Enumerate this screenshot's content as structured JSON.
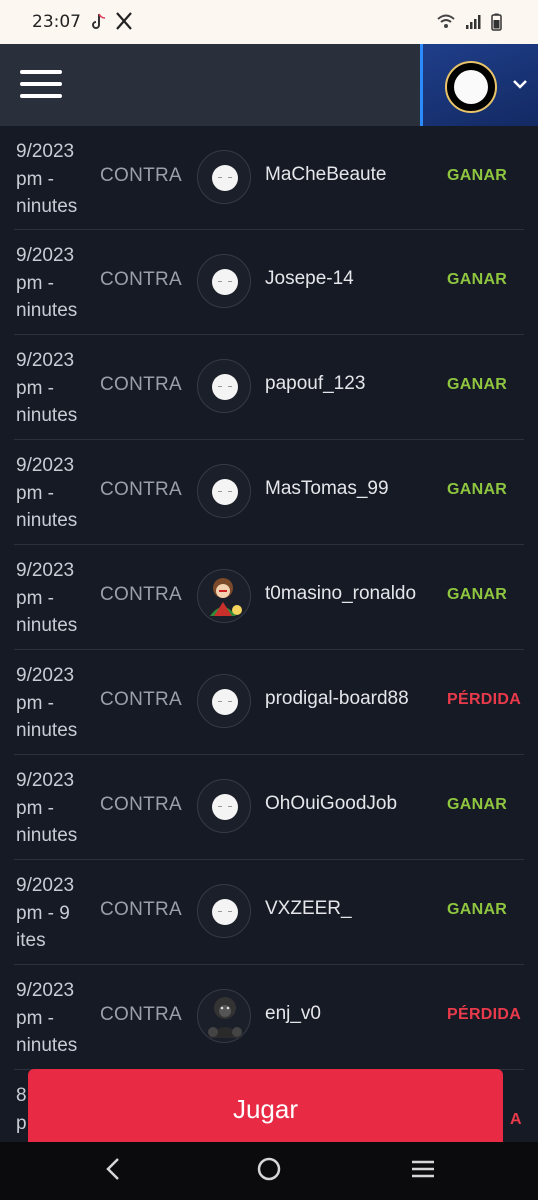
{
  "status": {
    "time": "23:07",
    "apps": [
      "tiktok-icon",
      "x-icon"
    ],
    "indicators": [
      "wifi-icon",
      "signal-icon",
      "battery-icon"
    ]
  },
  "topbar": {
    "menu_icon": "hamburger-icon",
    "dropdown_icon": "chevron-down-icon"
  },
  "games": [
    {
      "date_lines": [
        "9/2023",
        "pm -",
        "ninutes"
      ],
      "versus": "CONTRA",
      "opponent": "MaCheBeaute",
      "avatar": "default-face",
      "result": "GANAR",
      "result_type": "win"
    },
    {
      "date_lines": [
        "9/2023",
        "pm -",
        "ninutes"
      ],
      "versus": "CONTRA",
      "opponent": "Josepe-14",
      "avatar": "default-face",
      "result": "GANAR",
      "result_type": "win"
    },
    {
      "date_lines": [
        "9/2023",
        "pm -",
        "ninutes"
      ],
      "versus": "CONTRA",
      "opponent": "papouf_123",
      "avatar": "default-face",
      "result": "GANAR",
      "result_type": "win"
    },
    {
      "date_lines": [
        "9/2023",
        "pm -",
        "ninutes"
      ],
      "versus": "CONTRA",
      "opponent": "MasTomas_99",
      "avatar": "default-face",
      "result": "GANAR",
      "result_type": "win"
    },
    {
      "date_lines": [
        "9/2023",
        "pm -",
        "ninutes"
      ],
      "versus": "CONTRA",
      "opponent": "t0masino_ronaldo",
      "avatar": "character-picture",
      "result": "GANAR",
      "result_type": "win"
    },
    {
      "date_lines": [
        "9/2023",
        "pm -",
        "ninutes"
      ],
      "versus": "CONTRA",
      "opponent": "prodigal-board88",
      "avatar": "default-face",
      "result": "PÉRDIDA",
      "result_type": "loss"
    },
    {
      "date_lines": [
        "9/2023",
        "pm -",
        "ninutes"
      ],
      "versus": "CONTRA",
      "opponent": "OhOuiGoodJob",
      "avatar": "default-face",
      "result": "GANAR",
      "result_type": "win"
    },
    {
      "date_lines": [
        "9/2023",
        "pm - 9",
        "ites"
      ],
      "versus": "CONTRA",
      "opponent": "VXZEER_",
      "avatar": "default-face",
      "result": "GANAR",
      "result_type": "win"
    },
    {
      "date_lines": [
        "9/2023",
        "pm -",
        "ninutes"
      ],
      "versus": "CONTRA",
      "opponent": "enj_v0",
      "avatar": "gorilla-picture",
      "result": "PÉRDIDA",
      "result_type": "loss"
    },
    {
      "date_lines": [
        "8",
        "p",
        ""
      ],
      "versus": "",
      "opponent": "",
      "avatar": "",
      "result": "A",
      "result_type": "loss"
    }
  ],
  "play_button": {
    "label": "Jugar"
  },
  "colors": {
    "win": "#8ec63f",
    "loss": "#e83a4a",
    "play": "#e82a44"
  },
  "nav": {
    "back": "<",
    "home": "○",
    "recents": "≡"
  }
}
